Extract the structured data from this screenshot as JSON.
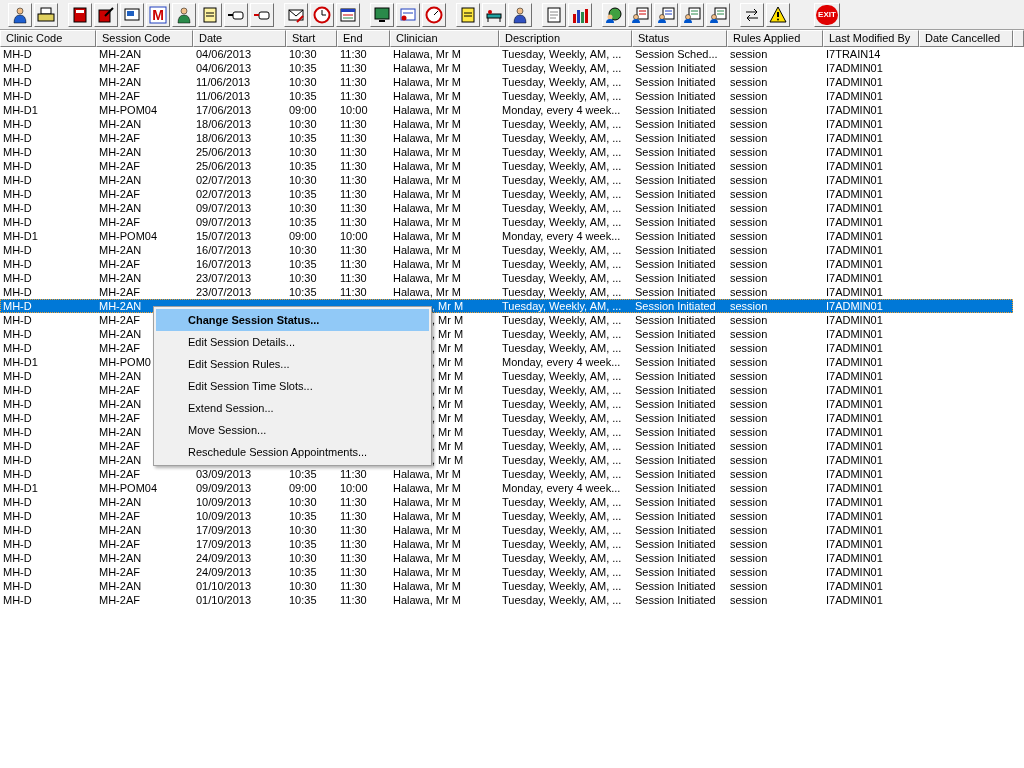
{
  "toolbar": {
    "m_label": "M",
    "exit_label": "EXIT"
  },
  "table": {
    "columns": [
      {
        "label": "Clinic Code"
      },
      {
        "label": "Session Code"
      },
      {
        "label": "Date"
      },
      {
        "label": "Start"
      },
      {
        "label": "End"
      },
      {
        "label": "Clinician"
      },
      {
        "label": "Description"
      },
      {
        "label": "Status"
      },
      {
        "label": "Rules Applied"
      },
      {
        "label": "Last Modified By"
      },
      {
        "label": "Date Cancelled"
      }
    ],
    "rows": [
      {
        "selected": false,
        "clinic_code": "MH-D",
        "session_code": "MH-2AN",
        "date": "04/06/2013",
        "start": "10:30",
        "end": "11:30",
        "clinician": "Halawa, Mr M",
        "description": "Tuesday, Weekly, AM, ...",
        "status": "Session Sched...",
        "rules_applied": "session",
        "last_modified_by": "I7TRAIN14"
      },
      {
        "selected": false,
        "clinic_code": "MH-D",
        "session_code": "MH-2AF",
        "date": "04/06/2013",
        "start": "10:35",
        "end": "11:30",
        "clinician": "Halawa, Mr M",
        "description": "Tuesday, Weekly, AM, ...",
        "status": "Session Initiated",
        "rules_applied": "session",
        "last_modified_by": "I7ADMIN01"
      },
      {
        "selected": false,
        "clinic_code": "MH-D",
        "session_code": "MH-2AN",
        "date": "11/06/2013",
        "start": "10:30",
        "end": "11:30",
        "clinician": "Halawa, Mr M",
        "description": "Tuesday, Weekly, AM, ...",
        "status": "Session Initiated",
        "rules_applied": "session",
        "last_modified_by": "I7ADMIN01"
      },
      {
        "selected": false,
        "clinic_code": "MH-D",
        "session_code": "MH-2AF",
        "date": "11/06/2013",
        "start": "10:35",
        "end": "11:30",
        "clinician": "Halawa, Mr M",
        "description": "Tuesday, Weekly, AM, ...",
        "status": "Session Initiated",
        "rules_applied": "session",
        "last_modified_by": "I7ADMIN01"
      },
      {
        "selected": false,
        "clinic_code": "MH-D1",
        "session_code": "MH-POM04",
        "date": "17/06/2013",
        "start": "09:00",
        "end": "10:00",
        "clinician": "Halawa, Mr M",
        "description": "Monday, every 4 week...",
        "status": "Session Initiated",
        "rules_applied": "session",
        "last_modified_by": "I7ADMIN01"
      },
      {
        "selected": false,
        "clinic_code": "MH-D",
        "session_code": "MH-2AN",
        "date": "18/06/2013",
        "start": "10:30",
        "end": "11:30",
        "clinician": "Halawa, Mr M",
        "description": "Tuesday, Weekly, AM, ...",
        "status": "Session Initiated",
        "rules_applied": "session",
        "last_modified_by": "I7ADMIN01"
      },
      {
        "selected": false,
        "clinic_code": "MH-D",
        "session_code": "MH-2AF",
        "date": "18/06/2013",
        "start": "10:35",
        "end": "11:30",
        "clinician": "Halawa, Mr M",
        "description": "Tuesday, Weekly, AM, ...",
        "status": "Session Initiated",
        "rules_applied": "session",
        "last_modified_by": "I7ADMIN01"
      },
      {
        "selected": false,
        "clinic_code": "MH-D",
        "session_code": "MH-2AN",
        "date": "25/06/2013",
        "start": "10:30",
        "end": "11:30",
        "clinician": "Halawa, Mr M",
        "description": "Tuesday, Weekly, AM, ...",
        "status": "Session Initiated",
        "rules_applied": "session",
        "last_modified_by": "I7ADMIN01"
      },
      {
        "selected": false,
        "clinic_code": "MH-D",
        "session_code": "MH-2AF",
        "date": "25/06/2013",
        "start": "10:35",
        "end": "11:30",
        "clinician": "Halawa, Mr M",
        "description": "Tuesday, Weekly, AM, ...",
        "status": "Session Initiated",
        "rules_applied": "session",
        "last_modified_by": "I7ADMIN01"
      },
      {
        "selected": false,
        "clinic_code": "MH-D",
        "session_code": "MH-2AN",
        "date": "02/07/2013",
        "start": "10:30",
        "end": "11:30",
        "clinician": "Halawa, Mr M",
        "description": "Tuesday, Weekly, AM, ...",
        "status": "Session Initiated",
        "rules_applied": "session",
        "last_modified_by": "I7ADMIN01"
      },
      {
        "selected": false,
        "clinic_code": "MH-D",
        "session_code": "MH-2AF",
        "date": "02/07/2013",
        "start": "10:35",
        "end": "11:30",
        "clinician": "Halawa, Mr M",
        "description": "Tuesday, Weekly, AM, ...",
        "status": "Session Initiated",
        "rules_applied": "session",
        "last_modified_by": "I7ADMIN01"
      },
      {
        "selected": false,
        "clinic_code": "MH-D",
        "session_code": "MH-2AN",
        "date": "09/07/2013",
        "start": "10:30",
        "end": "11:30",
        "clinician": "Halawa, Mr M",
        "description": "Tuesday, Weekly, AM, ...",
        "status": "Session Initiated",
        "rules_applied": "session",
        "last_modified_by": "I7ADMIN01"
      },
      {
        "selected": false,
        "clinic_code": "MH-D",
        "session_code": "MH-2AF",
        "date": "09/07/2013",
        "start": "10:35",
        "end": "11:30",
        "clinician": "Halawa, Mr M",
        "description": "Tuesday, Weekly, AM, ...",
        "status": "Session Initiated",
        "rules_applied": "session",
        "last_modified_by": "I7ADMIN01"
      },
      {
        "selected": false,
        "clinic_code": "MH-D1",
        "session_code": "MH-POM04",
        "date": "15/07/2013",
        "start": "09:00",
        "end": "10:00",
        "clinician": "Halawa, Mr M",
        "description": "Monday, every 4 week...",
        "status": "Session Initiated",
        "rules_applied": "session",
        "last_modified_by": "I7ADMIN01"
      },
      {
        "selected": false,
        "clinic_code": "MH-D",
        "session_code": "MH-2AN",
        "date": "16/07/2013",
        "start": "10:30",
        "end": "11:30",
        "clinician": "Halawa, Mr M",
        "description": "Tuesday, Weekly, AM, ...",
        "status": "Session Initiated",
        "rules_applied": "session",
        "last_modified_by": "I7ADMIN01"
      },
      {
        "selected": false,
        "clinic_code": "MH-D",
        "session_code": "MH-2AF",
        "date": "16/07/2013",
        "start": "10:35",
        "end": "11:30",
        "clinician": "Halawa, Mr M",
        "description": "Tuesday, Weekly, AM, ...",
        "status": "Session Initiated",
        "rules_applied": "session",
        "last_modified_by": "I7ADMIN01"
      },
      {
        "selected": false,
        "clinic_code": "MH-D",
        "session_code": "MH-2AN",
        "date": "23/07/2013",
        "start": "10:30",
        "end": "11:30",
        "clinician": "Halawa, Mr M",
        "description": "Tuesday, Weekly, AM, ...",
        "status": "Session Initiated",
        "rules_applied": "session",
        "last_modified_by": "I7ADMIN01"
      },
      {
        "selected": false,
        "clinic_code": "MH-D",
        "session_code": "MH-2AF",
        "date": "23/07/2013",
        "start": "10:35",
        "end": "11:30",
        "clinician": "Halawa, Mr M",
        "description": "Tuesday, Weekly, AM, ...",
        "status": "Session Initiated",
        "rules_applied": "session",
        "last_modified_by": "I7ADMIN01"
      },
      {
        "selected": true,
        "clinic_code": "MH-D",
        "session_code": "MH-2AN",
        "clinician": ", Mr M",
        "description": "Tuesday, Weekly, AM, ...",
        "status": "Session Initiated",
        "rules_applied": "session",
        "last_modified_by": "I7ADMIN01"
      },
      {
        "selected": false,
        "clinic_code": "MH-D",
        "session_code": "MH-2AF",
        "clinician": ", Mr M",
        "description": "Tuesday, Weekly, AM, ...",
        "status": "Session Initiated",
        "rules_applied": "session",
        "last_modified_by": "I7ADMIN01"
      },
      {
        "selected": false,
        "clinic_code": "MH-D",
        "session_code": "MH-2AN",
        "clinician": ", Mr M",
        "description": "Tuesday, Weekly, AM, ...",
        "status": "Session Initiated",
        "rules_applied": "session",
        "last_modified_by": "I7ADMIN01"
      },
      {
        "selected": false,
        "clinic_code": "MH-D",
        "session_code": "MH-2AF",
        "clinician": ", Mr M",
        "description": "Tuesday, Weekly, AM, ...",
        "status": "Session Initiated",
        "rules_applied": "session",
        "last_modified_by": "I7ADMIN01"
      },
      {
        "selected": false,
        "clinic_code": "MH-D1",
        "session_code": "MH-POM0",
        "clinician": ", Mr M",
        "description": "Monday, every 4 week...",
        "status": "Session Initiated",
        "rules_applied": "session",
        "last_modified_by": "I7ADMIN01"
      },
      {
        "selected": false,
        "clinic_code": "MH-D",
        "session_code": "MH-2AN",
        "clinician": ", Mr M",
        "description": "Tuesday, Weekly, AM, ...",
        "status": "Session Initiated",
        "rules_applied": "session",
        "last_modified_by": "I7ADMIN01"
      },
      {
        "selected": false,
        "clinic_code": "MH-D",
        "session_code": "MH-2AF",
        "clinician": ", Mr M",
        "description": "Tuesday, Weekly, AM, ...",
        "status": "Session Initiated",
        "rules_applied": "session",
        "last_modified_by": "I7ADMIN01"
      },
      {
        "selected": false,
        "clinic_code": "MH-D",
        "session_code": "MH-2AN",
        "clinician": ", Mr M",
        "description": "Tuesday, Weekly, AM, ...",
        "status": "Session Initiated",
        "rules_applied": "session",
        "last_modified_by": "I7ADMIN01"
      },
      {
        "selected": false,
        "clinic_code": "MH-D",
        "session_code": "MH-2AF",
        "clinician": ", Mr M",
        "description": "Tuesday, Weekly, AM, ...",
        "status": "Session Initiated",
        "rules_applied": "session",
        "last_modified_by": "I7ADMIN01"
      },
      {
        "selected": false,
        "clinic_code": "MH-D",
        "session_code": "MH-2AN",
        "clinician": ", Mr M",
        "description": "Tuesday, Weekly, AM, ...",
        "status": "Session Initiated",
        "rules_applied": "session",
        "last_modified_by": "I7ADMIN01"
      },
      {
        "selected": false,
        "clinic_code": "MH-D",
        "session_code": "MH-2AF",
        "clinician": ", Mr M",
        "description": "Tuesday, Weekly, AM, ...",
        "status": "Session Initiated",
        "rules_applied": "session",
        "last_modified_by": "I7ADMIN01"
      },
      {
        "selected": false,
        "clinic_code": "MH-D",
        "session_code": "MH-2AN",
        "clinician": ", Mr M",
        "description": "Tuesday, Weekly, AM, ...",
        "status": "Session Initiated",
        "rules_applied": "session",
        "last_modified_by": "I7ADMIN01"
      },
      {
        "selected": false,
        "clinic_code": "MH-D",
        "session_code": "MH-2AF",
        "date": "03/09/2013",
        "start": "10:35",
        "end": "11:30",
        "clinician": "Halawa, Mr M",
        "description": "Tuesday, Weekly, AM, ...",
        "status": "Session Initiated",
        "rules_applied": "session",
        "last_modified_by": "I7ADMIN01"
      },
      {
        "selected": false,
        "clinic_code": "MH-D1",
        "session_code": "MH-POM04",
        "date": "09/09/2013",
        "start": "09:00",
        "end": "10:00",
        "clinician": "Halawa, Mr M",
        "description": "Monday, every 4 week...",
        "status": "Session Initiated",
        "rules_applied": "session",
        "last_modified_by": "I7ADMIN01"
      },
      {
        "selected": false,
        "clinic_code": "MH-D",
        "session_code": "MH-2AN",
        "date": "10/09/2013",
        "start": "10:30",
        "end": "11:30",
        "clinician": "Halawa, Mr M",
        "description": "Tuesday, Weekly, AM, ...",
        "status": "Session Initiated",
        "rules_applied": "session",
        "last_modified_by": "I7ADMIN01"
      },
      {
        "selected": false,
        "clinic_code": "MH-D",
        "session_code": "MH-2AF",
        "date": "10/09/2013",
        "start": "10:35",
        "end": "11:30",
        "clinician": "Halawa, Mr M",
        "description": "Tuesday, Weekly, AM, ...",
        "status": "Session Initiated",
        "rules_applied": "session",
        "last_modified_by": "I7ADMIN01"
      },
      {
        "selected": false,
        "clinic_code": "MH-D",
        "session_code": "MH-2AN",
        "date": "17/09/2013",
        "start": "10:30",
        "end": "11:30",
        "clinician": "Halawa, Mr M",
        "description": "Tuesday, Weekly, AM, ...",
        "status": "Session Initiated",
        "rules_applied": "session",
        "last_modified_by": "I7ADMIN01"
      },
      {
        "selected": false,
        "clinic_code": "MH-D",
        "session_code": "MH-2AF",
        "date": "17/09/2013",
        "start": "10:35",
        "end": "11:30",
        "clinician": "Halawa, Mr M",
        "description": "Tuesday, Weekly, AM, ...",
        "status": "Session Initiated",
        "rules_applied": "session",
        "last_modified_by": "I7ADMIN01"
      },
      {
        "selected": false,
        "clinic_code": "MH-D",
        "session_code": "MH-2AN",
        "date": "24/09/2013",
        "start": "10:30",
        "end": "11:30",
        "clinician": "Halawa, Mr M",
        "description": "Tuesday, Weekly, AM, ...",
        "status": "Session Initiated",
        "rules_applied": "session",
        "last_modified_by": "I7ADMIN01"
      },
      {
        "selected": false,
        "clinic_code": "MH-D",
        "session_code": "MH-2AF",
        "date": "24/09/2013",
        "start": "10:35",
        "end": "11:30",
        "clinician": "Halawa, Mr M",
        "description": "Tuesday, Weekly, AM, ...",
        "status": "Session Initiated",
        "rules_applied": "session",
        "last_modified_by": "I7ADMIN01"
      },
      {
        "selected": false,
        "clinic_code": "MH-D",
        "session_code": "MH-2AN",
        "date": "01/10/2013",
        "start": "10:30",
        "end": "11:30",
        "clinician": "Halawa, Mr M",
        "description": "Tuesday, Weekly, AM, ...",
        "status": "Session Initiated",
        "rules_applied": "session",
        "last_modified_by": "I7ADMIN01"
      },
      {
        "selected": false,
        "clinic_code": "MH-D",
        "session_code": "MH-2AF",
        "date": "01/10/2013",
        "start": "10:35",
        "end": "11:30",
        "clinician": "Halawa, Mr M",
        "description": "Tuesday, Weekly, AM, ...",
        "status": "Session Initiated",
        "rules_applied": "session",
        "last_modified_by": "I7ADMIN01"
      }
    ]
  },
  "context_menu": {
    "items": [
      {
        "label": "Change Session Status...",
        "selected": true,
        "default": true
      },
      {
        "label": "Edit Session Details...",
        "selected": false,
        "default": false
      },
      {
        "label": "Edit Session Rules...",
        "selected": false,
        "default": false
      },
      {
        "label": "Edit Session Time Slots...",
        "selected": false,
        "default": false
      },
      {
        "label": "Extend Session...",
        "selected": false,
        "default": false
      },
      {
        "label": "Move Session...",
        "selected": false,
        "default": false
      },
      {
        "label": "Reschedule Session Appointments...",
        "selected": false,
        "default": false
      }
    ]
  }
}
